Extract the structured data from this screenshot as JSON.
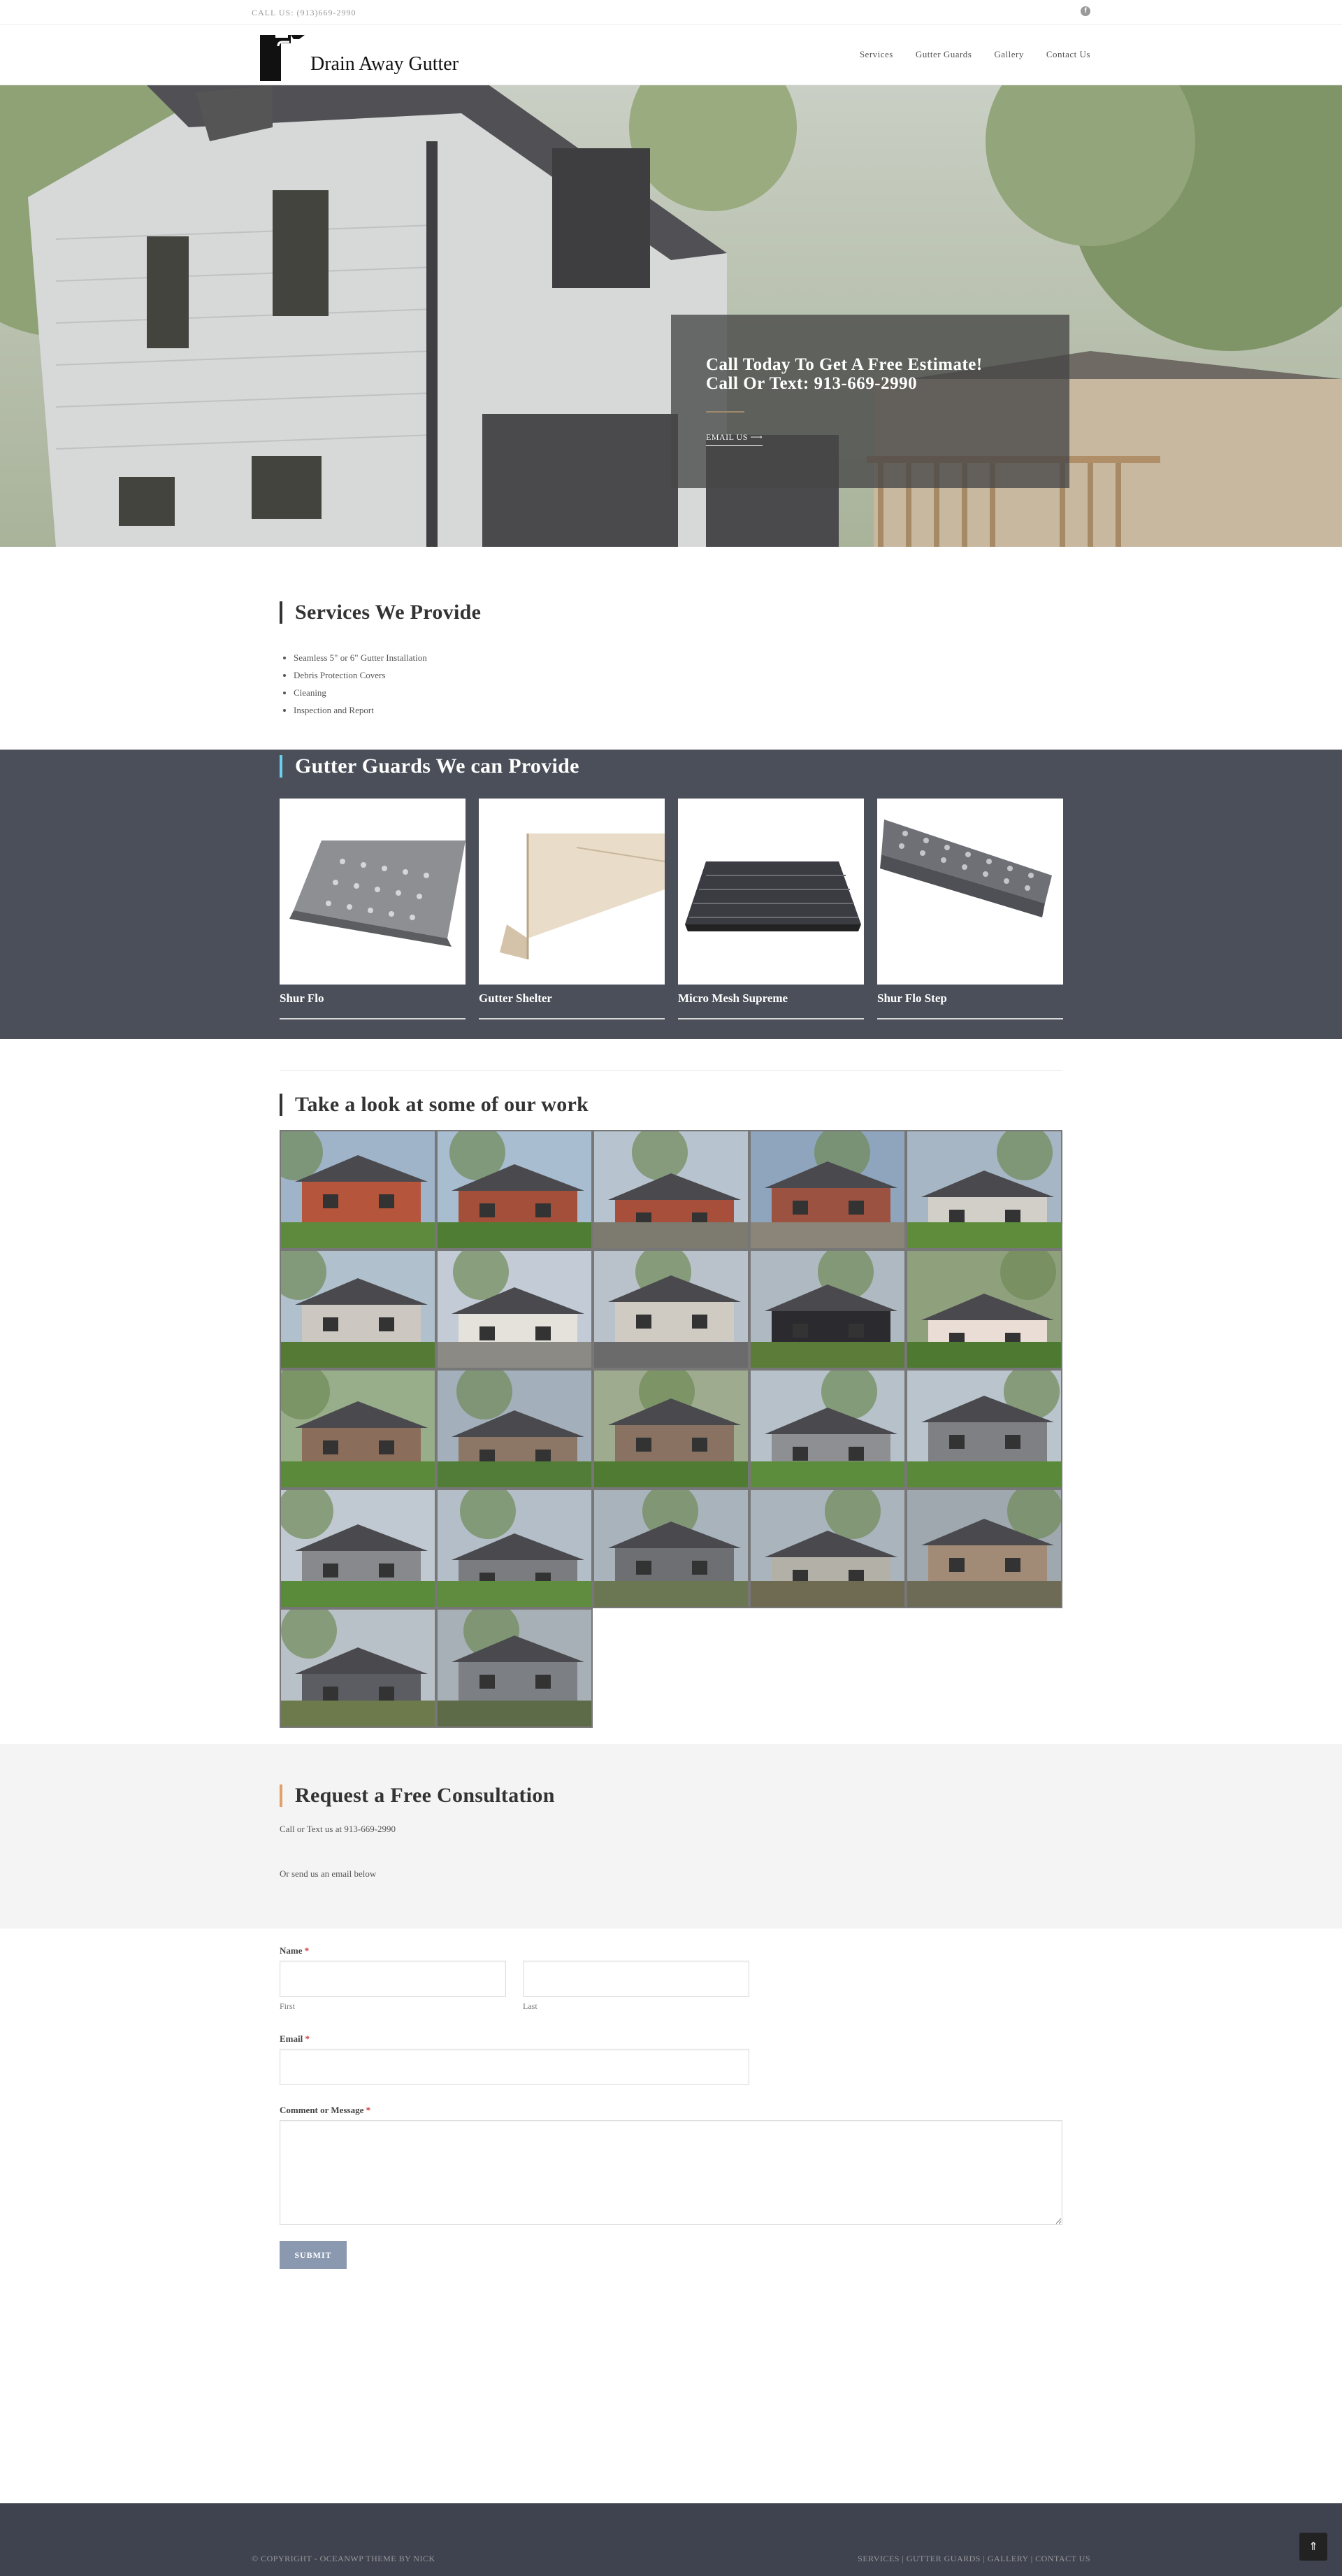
{
  "topbar": {
    "call": "CALL US: (913)669-2990",
    "social_icon": "facebook-icon"
  },
  "header": {
    "logo_text": "Drain Away Gutter",
    "nav": [
      "Services",
      "Gutter Guards",
      "Gallery",
      "Contact Us"
    ]
  },
  "hero": {
    "heading_line1": "Call Today To Get A Free Estimate!",
    "heading_line2": "Call Or Text: 913-669-2990",
    "email_label": "EMAIL US",
    "arrow": "⟶"
  },
  "services": {
    "title": "Services We Provide",
    "items": [
      "Seamless 5\" or 6\" Gutter Installation",
      "Debris Protection Covers",
      "Cleaning",
      "Inspection and Report"
    ]
  },
  "guards": {
    "title": "Gutter Guards We can Provide",
    "items": [
      "Shur Flo",
      "Gutter Shelter",
      "Micro Mesh Supreme",
      "Shur Flo Step"
    ]
  },
  "work": {
    "title": "Take a look at some of our work",
    "photo_count": 22
  },
  "consult": {
    "title": "Request a Free Consultation",
    "line1": "Call or Text us at 913-669-2990",
    "line2": "Or send us an email below"
  },
  "form": {
    "name_label": "Name",
    "first_label": "First",
    "last_label": "Last",
    "email_label": "Email",
    "message_label": "Comment or Message",
    "required_mark": "*",
    "submit_label": "SUBMIT"
  },
  "footer": {
    "copyright": "© COPYRIGHT - OCEANWP THEME BY NICK",
    "links": [
      "SERVICES",
      "GUTTER GUARDS",
      "GALLERY",
      "CONTACT US"
    ],
    "separator": " | ",
    "scroll_top_icon": "chevron-double-up-icon"
  },
  "colors": {
    "guards_bg": "#4a4f59",
    "footer_bg": "#3f4350",
    "submit_bg": "#8a98b0",
    "consult_bg": "#f4f4f4"
  }
}
